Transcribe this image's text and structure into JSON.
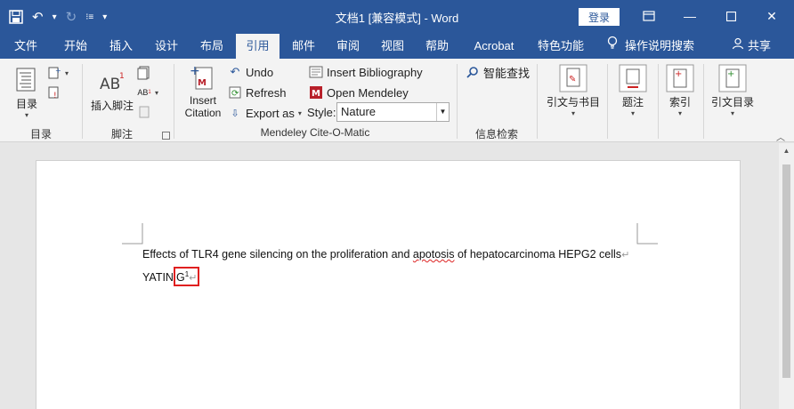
{
  "window": {
    "title": "文档1 [兼容模式] - Word",
    "login_label": "登录"
  },
  "tabs": [
    {
      "label": "文件"
    },
    {
      "label": "开始"
    },
    {
      "label": "插入"
    },
    {
      "label": "设计"
    },
    {
      "label": "布局"
    },
    {
      "label": "引用"
    },
    {
      "label": "邮件"
    },
    {
      "label": "审阅"
    },
    {
      "label": "视图"
    },
    {
      "label": "帮助"
    },
    {
      "label": "Acrobat"
    },
    {
      "label": "特色功能"
    }
  ],
  "tell_me": "操作说明搜索",
  "share": "共享",
  "ribbon": {
    "toc": {
      "button": "目录",
      "group": "目录"
    },
    "footnotes": {
      "insert_footnote": "插入脚注",
      "group": "脚注"
    },
    "mendeley": {
      "insert_citation_line1": "Insert",
      "insert_citation_line2": "Citation",
      "undo": "Undo",
      "refresh": "Refresh",
      "export_as": "Export as",
      "insert_bibliography": "Insert Bibliography",
      "open_mendeley": "Open Mendeley",
      "style_label": "Style:",
      "style_value": "Nature",
      "group": "Mendeley Cite-O-Matic"
    },
    "research": {
      "smart_lookup": "智能查找",
      "group": "信息检索"
    },
    "citations": {
      "button": "引文与书目"
    },
    "captions": {
      "button": "题注"
    },
    "index": {
      "button": "索引"
    },
    "authorities": {
      "button": "引文目录"
    }
  },
  "document": {
    "line1": "Effects of TLR4 gene silencing on the proliferation and ",
    "line1_misspelled": "apotosis",
    "line1_rest": " of hepatocarcinoma HEPG2 cells",
    "line2_author": "YATIN",
    "line2_cite_letter": "G",
    "line2_cite_sup": "1",
    "paragraph_mark": "↵"
  },
  "colors": {
    "brand": "#2b579a",
    "ribbon_bg": "#f3f3f3",
    "highlight_box": "#e02020"
  }
}
